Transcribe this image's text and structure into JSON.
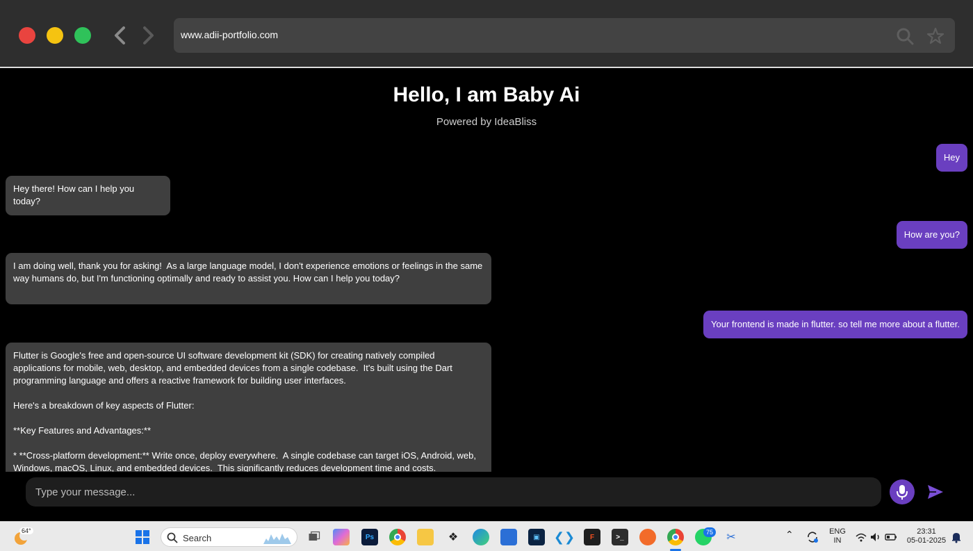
{
  "browser": {
    "url": "www.adii-portfolio.com"
  },
  "chat": {
    "title": "Hello, I am Baby Ai",
    "subtitle": "Powered by IdeaBliss",
    "messages": [
      {
        "role": "user",
        "text": "Hey"
      },
      {
        "role": "bot",
        "text": "Hey there! How can I help you today?"
      },
      {
        "role": "user",
        "text": "How are you?"
      },
      {
        "role": "bot",
        "text": "I am doing well, thank you for asking!  As a large language model, I don't experience emotions or feelings in the same way humans do, but I'm functioning optimally and ready to assist you. How can I help you today?"
      },
      {
        "role": "user",
        "text": "Your frontend is made in flutter. so tell me more about a flutter."
      },
      {
        "role": "bot",
        "text": "Flutter is Google's free and open-source UI software development kit (SDK) for creating natively compiled applications for mobile, web, desktop, and embedded devices from a single codebase.  It's built using the Dart programming language and offers a reactive framework for building user interfaces.\n\nHere's a breakdown of key aspects of Flutter:\n\n**Key Features and Advantages:**\n\n* **Cross-platform development:** Write once, deploy everywhere.  A single codebase can target iOS, Android, web, Windows, macOS, Linux, and embedded devices.  This significantly reduces development time and costs."
      }
    ],
    "input_placeholder": "Type your message..."
  },
  "taskbar": {
    "weather_temp": "64°",
    "search_label": "Search",
    "whatsapp_badge": "75",
    "language_line1": "ENG",
    "language_line2": "IN",
    "time": "23:31",
    "date": "05-01-2025"
  },
  "colors": {
    "user_bubble": "#6a3fc0",
    "bot_bubble": "#3f3f3f",
    "chrome_bg": "#2e2e2e",
    "urlbar_bg": "#434343"
  }
}
